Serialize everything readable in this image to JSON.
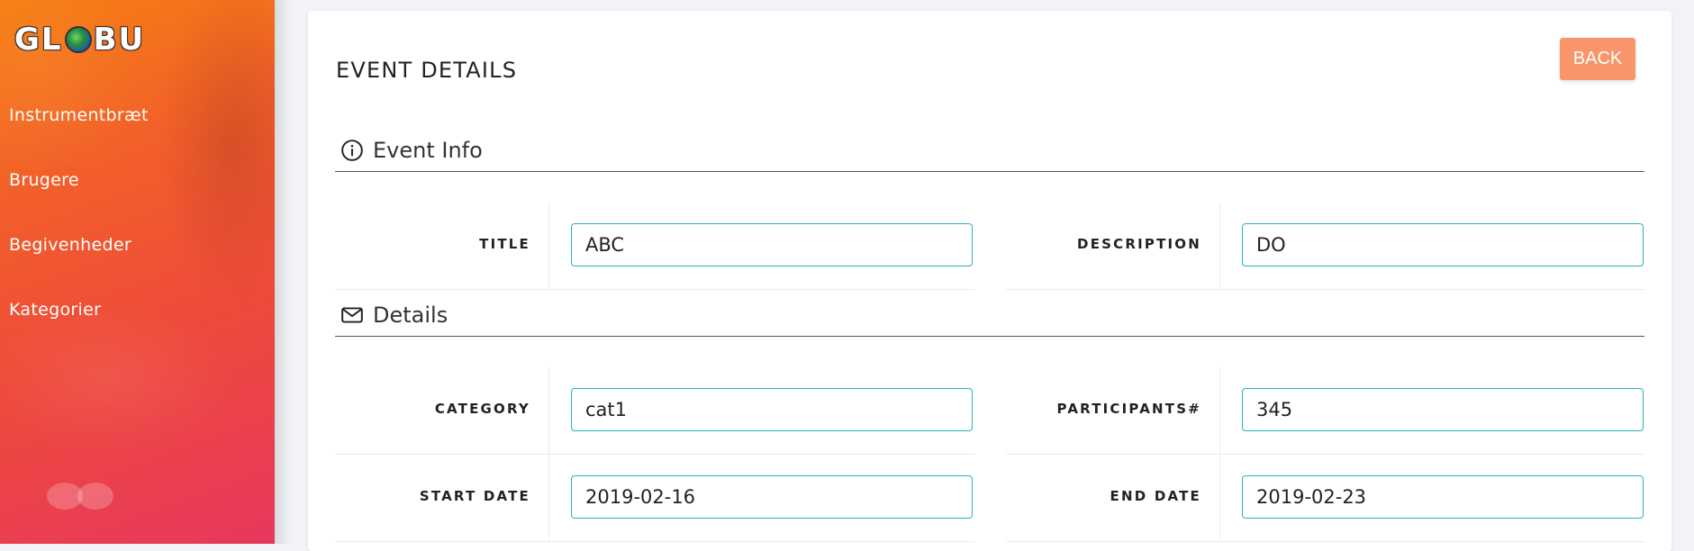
{
  "app": {
    "logo_text_left": "GL",
    "logo_text_right": "BU"
  },
  "sidebar": {
    "items": [
      {
        "label": "Instrumentbræt"
      },
      {
        "label": "Brugere"
      },
      {
        "label": "Begivenheder"
      },
      {
        "label": "Kategorier"
      }
    ]
  },
  "page": {
    "title": "EVENT DETAILS",
    "back_label": "BACK"
  },
  "sections": {
    "event_info": {
      "title": "Event Info",
      "icon": "info-circle-icon"
    },
    "details": {
      "title": "Details",
      "icon": "envelope-icon"
    }
  },
  "fields": {
    "title": {
      "label": "TITLE",
      "value": "ABC"
    },
    "description": {
      "label": "DESCRIPTION",
      "value": "DO"
    },
    "category": {
      "label": "CATEGORY",
      "value": "cat1"
    },
    "participants": {
      "label": "PARTICIPANTS#",
      "value": "345"
    },
    "start_date": {
      "label": "START DATE",
      "value": "2019-02-16"
    },
    "end_date": {
      "label": "END DATE",
      "value": "2019-02-23"
    }
  },
  "colors": {
    "accent_teal": "#26b3bd",
    "button_orange": "#f9956b",
    "sidebar_gradient_start": "#f77f12",
    "sidebar_gradient_end": "#e8375e"
  }
}
